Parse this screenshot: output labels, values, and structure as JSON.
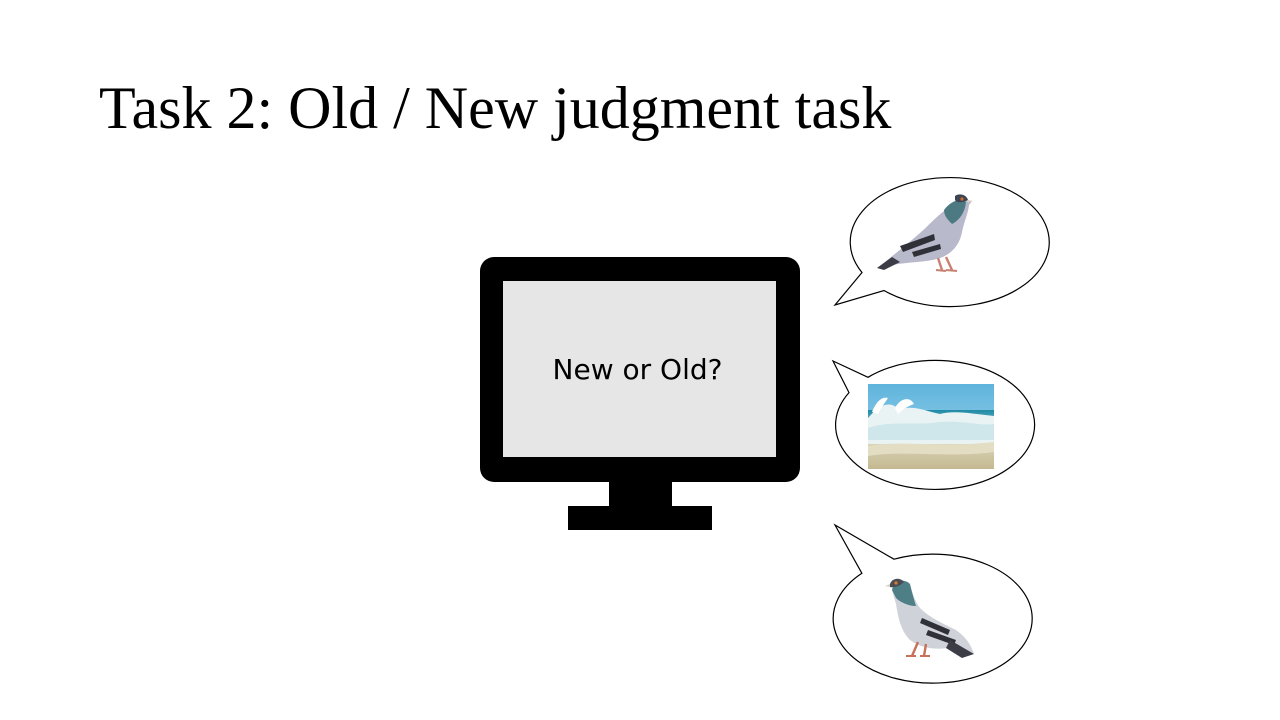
{
  "slide": {
    "title": "Task 2: Old / New judgment task"
  },
  "monitor": {
    "prompt_text": "New or Old?"
  },
  "bubbles": [
    {
      "content": "pigeon-standing-image"
    },
    {
      "content": "ocean-wave-image"
    },
    {
      "content": "pigeon-walking-image"
    }
  ],
  "colors": {
    "background": "#ffffff",
    "monitor": "#000000",
    "screen": "#e7e6e6",
    "bubble_stroke": "#000000"
  }
}
